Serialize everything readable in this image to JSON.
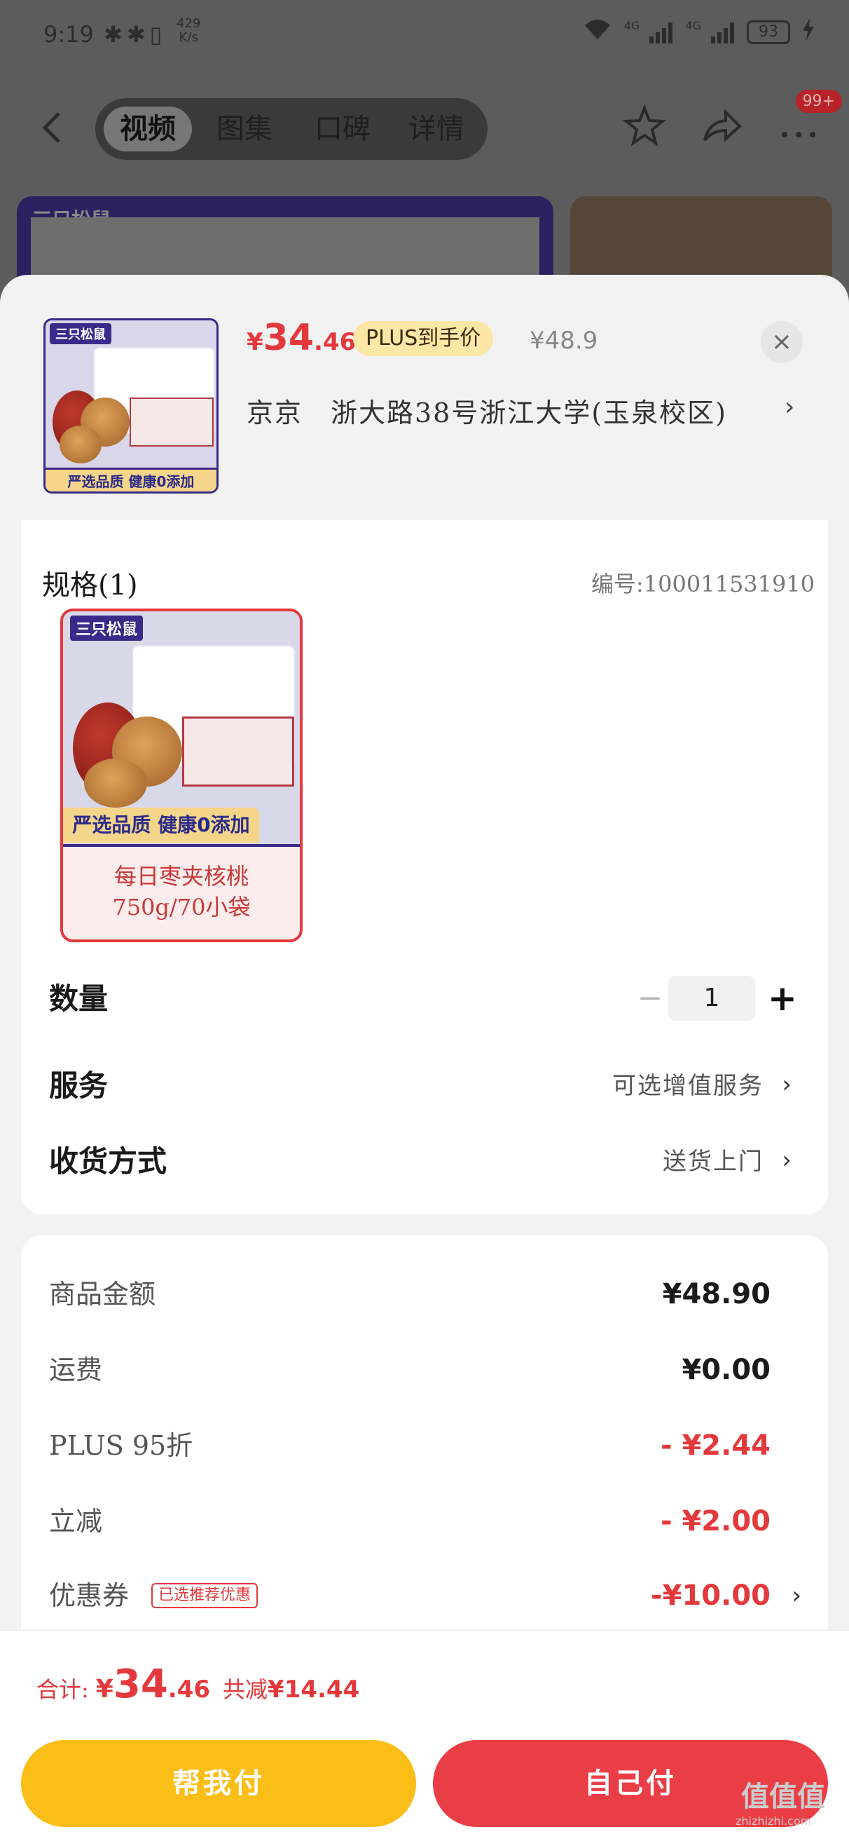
{
  "status_bar": {
    "time": "9:19",
    "net_speed_value": "429",
    "net_speed_unit": "K/s",
    "signal_1": "4G",
    "signal_2": "4G",
    "battery": "93"
  },
  "nav": {
    "tabs": [
      {
        "label": "视频",
        "active": true
      },
      {
        "label": "图集",
        "active": false
      },
      {
        "label": "口碑",
        "active": false
      },
      {
        "label": "详情",
        "active": false
      }
    ],
    "badge": "99+"
  },
  "background": {
    "brand": "三只松鼠"
  },
  "sheet": {
    "thumb_brand": "三只松鼠",
    "thumb_tag": "严选品质 健康0添加",
    "price_yen": "¥",
    "price_int": "34",
    "price_dec": ".46",
    "plus_label": "PLUS到手价",
    "orig_price": "¥48.9",
    "close": "×",
    "address": "京京　浙大路38号浙江大学(玉泉校区)",
    "address_arrow": "›"
  },
  "spec": {
    "title": "规格(1)",
    "sku": "编号:100011531910",
    "option": {
      "brand": "三只松鼠",
      "tag": "严选品质 健康0添加",
      "name_line1": "每日枣夹核桃",
      "name_line2": "750g/70小袋"
    }
  },
  "quantity": {
    "label": "数量",
    "minus": "−",
    "value": "1",
    "plus": "+"
  },
  "service": {
    "label": "服务",
    "value": "可选增值服务",
    "arrow": "›"
  },
  "delivery": {
    "label": "收货方式",
    "value": "送货上门",
    "arrow": "›"
  },
  "fees": [
    {
      "label": "商品金额",
      "value": "¥48.90"
    },
    {
      "label": "运费",
      "value": "¥0.00"
    },
    {
      "label": "PLUS 95折",
      "value": "- ¥2.44"
    },
    {
      "label": "立减",
      "value": "- ¥2.00"
    },
    {
      "label": "优惠券",
      "value": "-¥10.00",
      "tag": "已选推荐优惠",
      "arrow": "›"
    }
  ],
  "footer": {
    "total_label": "合计:",
    "total_yen": "¥",
    "total_int": "34",
    "total_dec": ".46",
    "save_label": "共减",
    "save_value": "¥14.44",
    "btn_help": "帮我付",
    "btn_self": "自己付"
  },
  "watermark": {
    "text": "值值值",
    "sub": "zhizhizhi.com"
  },
  "colors": {
    "accent_red": "#e4393c",
    "button_yellow": "#fbbd18",
    "button_red": "#ea3e46",
    "plus_tag_bg": "#fce7a6"
  }
}
